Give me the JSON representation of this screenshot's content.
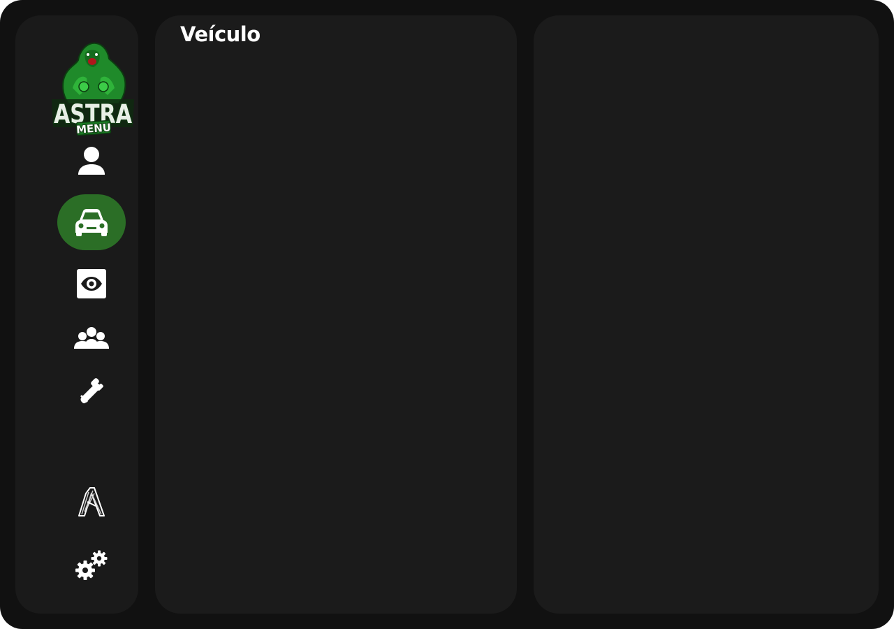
{
  "app": {
    "logo": {
      "title": "ASTRA",
      "subtitle": "MENU"
    }
  },
  "sidebar": {
    "items": [
      {
        "icon": "user-icon",
        "active": false
      },
      {
        "icon": "car-icon",
        "active": true
      },
      {
        "icon": "eye-icon",
        "active": false
      },
      {
        "icon": "group-icon",
        "active": false
      },
      {
        "icon": "weapon-icon",
        "active": false
      }
    ],
    "bottom_items": [
      {
        "icon": "brand-icon"
      },
      {
        "icon": "gears-icon"
      }
    ]
  },
  "main": {
    "title": "Veículo"
  },
  "colors": {
    "window_bg": "#111111",
    "panel_bg": "#1b1b1b",
    "sidebar_bg": "#1a1a1a",
    "accent": "#2b6e26",
    "text": "#ffffff"
  }
}
